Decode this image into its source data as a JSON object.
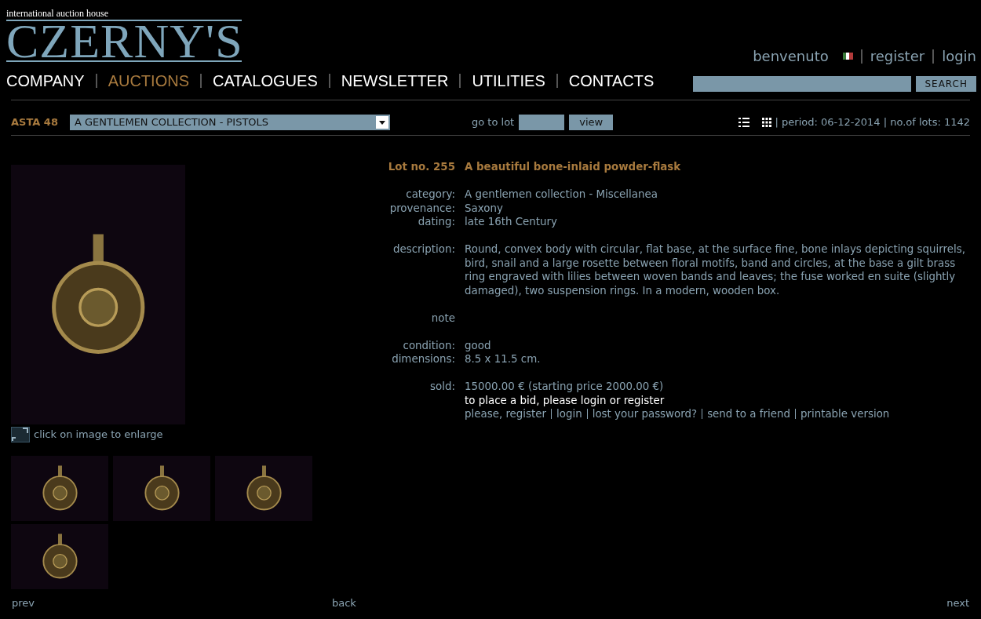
{
  "logo": {
    "tagline": "international auction house",
    "name": "CZERNY'S"
  },
  "top_links": {
    "greeting": "benvenuto",
    "items": [
      "register",
      "login"
    ]
  },
  "nav": [
    {
      "label": "COMPANY",
      "selected": false
    },
    {
      "label": "AUCTIONS",
      "selected": true
    },
    {
      "label": "CATALOGUES",
      "selected": false
    },
    {
      "label": "NEWSLETTER",
      "selected": false
    },
    {
      "label": "UTILITIES",
      "selected": false
    },
    {
      "label": "CONTACTS",
      "selected": false
    }
  ],
  "search": {
    "button": "SEARCH"
  },
  "auction_bar": {
    "auction": "ASTA 48",
    "collection": "A GENTLEMEN COLLECTION - PISTOLS",
    "goto_label": "go to lot",
    "view_button": "view",
    "period": "| period: 06-12-2014 | no.of lots: 1142"
  },
  "lot": {
    "number": "Lot no. 255",
    "title": "A beautiful bone-inlaid powder-flask",
    "groups": [
      [
        {
          "label": "category:",
          "value": "A gentlemen collection - Miscellanea"
        },
        {
          "label": "provenance:",
          "value": "Saxony"
        },
        {
          "label": "dating:",
          "value": "late 16th Century"
        }
      ],
      [
        {
          "label": "description:",
          "value": "Round, convex body with circular, flat base, at the surface fine, bone inlays depicting squirrels, bird, snail and a large rosette between floral motifs, band and circles, at the base a gilt brass ring engraved with lilies between woven bands and leaves; the fuse worked en suite (slightly damaged), two suspension rings. In a modern, wooden box."
        }
      ],
      [
        {
          "label": "note"
        }
      ],
      [
        {
          "label": "condition:",
          "value": "good"
        },
        {
          "label": "dimensions:",
          "value": "8.5 x 11.5 cm."
        }
      ],
      [
        {
          "label": "sold:",
          "value": "15000.00 € (starting price 2000.00 €)"
        }
      ]
    ],
    "bid_notice": "to place a bid, please login or register",
    "links": [
      "please, register",
      "login",
      "lost your password?",
      "send to a friend",
      "printable version"
    ]
  },
  "enlarge_hint": "click on image to enlarge",
  "pager": {
    "prev": "prev",
    "back": "back",
    "next": "next"
  }
}
